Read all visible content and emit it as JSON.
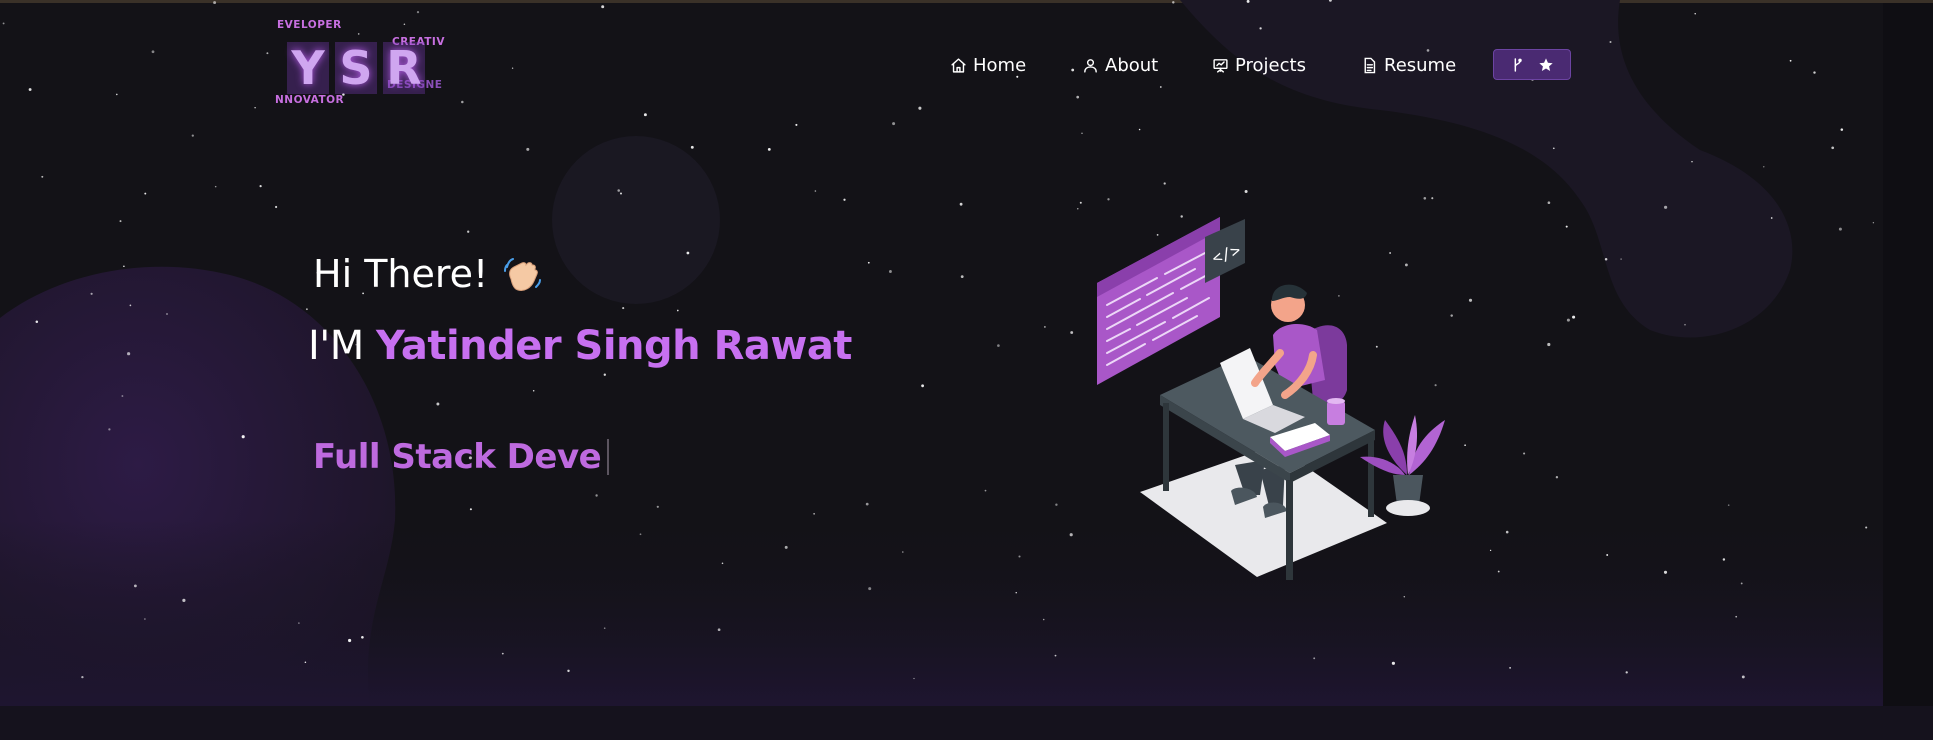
{
  "logo": {
    "words": [
      "EVELOPER",
      "CREATIV",
      "DESIGNE",
      "NNOVATOR"
    ],
    "letters": [
      "Y",
      "S",
      "R"
    ]
  },
  "nav": {
    "items": [
      {
        "label": "Home",
        "icon": "home-icon"
      },
      {
        "label": "About",
        "icon": "user-icon"
      },
      {
        "label": "Projects",
        "icon": "presentation-icon"
      },
      {
        "label": "Resume",
        "icon": "document-icon"
      }
    ],
    "star_button": {
      "icons": [
        "git-fork-icon",
        "star-icon"
      ]
    }
  },
  "hero": {
    "greeting": "Hi There!",
    "intro_prefix": "I'M",
    "name": "Yatinder Singh Rawat",
    "typewriter_text": "Full Stack Deve"
  },
  "colors": {
    "background": "#131217",
    "accent": "#c770f0",
    "nav_button": "#4a2a72",
    "blob": "#2a1c3f"
  }
}
